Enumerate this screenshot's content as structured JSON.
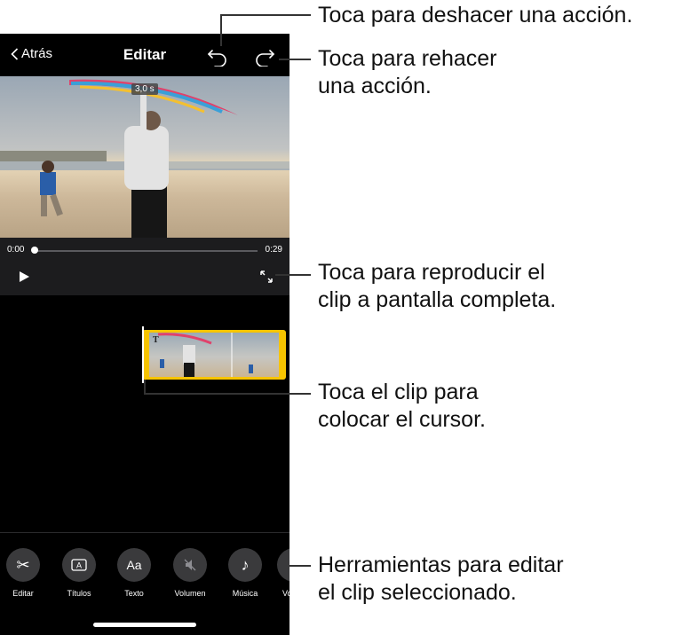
{
  "navbar": {
    "back_label": "Atrás",
    "title": "Editar"
  },
  "video": {
    "duration_badge": "3,0 s"
  },
  "playback": {
    "current_time": "0:00",
    "total_time": "0:29",
    "progress_fraction": 0.0
  },
  "clip": {
    "title_marker": "T"
  },
  "toolbar": {
    "items": [
      {
        "label": "Editar",
        "glyph": "✂"
      },
      {
        "label": "Títulos",
        "glyph": "A"
      },
      {
        "label": "Texto",
        "glyph": "Aa"
      },
      {
        "label": "Volumen",
        "glyph": ""
      },
      {
        "label": "Música",
        "glyph": "♪"
      },
      {
        "label": "Vo",
        "glyph": ""
      }
    ]
  },
  "callouts": {
    "undo": "Toca para deshacer una acción.",
    "redo_line1": "Toca para rehacer",
    "redo_line2": "una acción.",
    "fullscreen_line1": "Toca para reproducir el",
    "fullscreen_line2": "clip a pantalla completa.",
    "clip_line1": "Toca el clip para",
    "clip_line2": "colocar el cursor.",
    "tools_line1": "Herramientas para editar",
    "tools_line2": "el clip seleccionado."
  },
  "colors": {
    "clip_border": "#f7c400",
    "background": "#000000",
    "controls_bg": "#1c1c1e"
  }
}
